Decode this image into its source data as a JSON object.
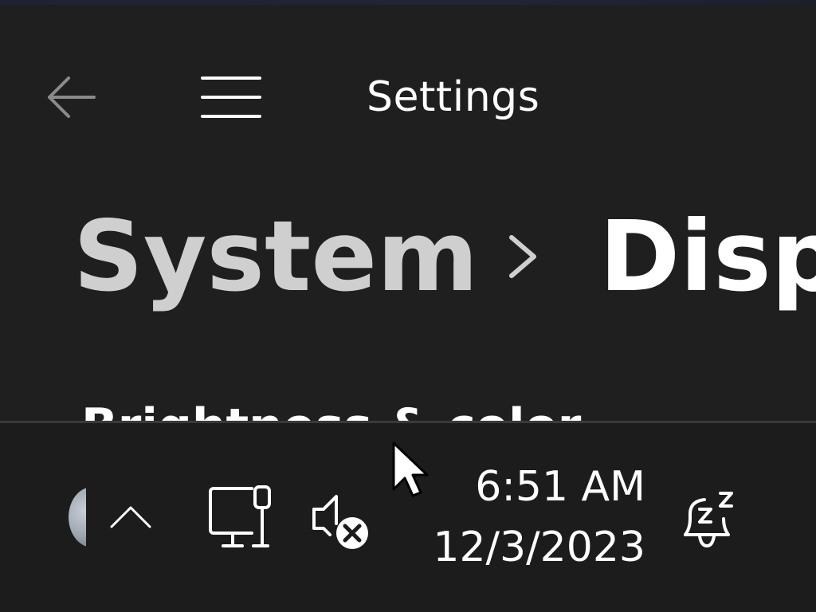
{
  "titlebar": {
    "app_title": "Settings",
    "back_icon": "back-arrow-icon",
    "menu_icon": "hamburger-menu-icon"
  },
  "breadcrumb": {
    "parent": "System",
    "separator_icon": "chevron-right-icon",
    "current": "Disp"
  },
  "section_peek": "Brightness & color",
  "taskbar": {
    "tray_app_icon": "app-avatar-icon",
    "overflow_icon": "chevron-up-icon",
    "network_icon": "ethernet-network-icon",
    "volume_icon": "volume-muted-icon",
    "clock": {
      "time": "6:51 AM",
      "date": "12/3/2023"
    },
    "notifications_icon": "notification-bell-snooze-icon"
  },
  "colors": {
    "background": "#1f1f1f",
    "taskbar": "#1c1c1c",
    "text_primary": "#ffffff",
    "text_secondary": "#cfcfcf"
  }
}
